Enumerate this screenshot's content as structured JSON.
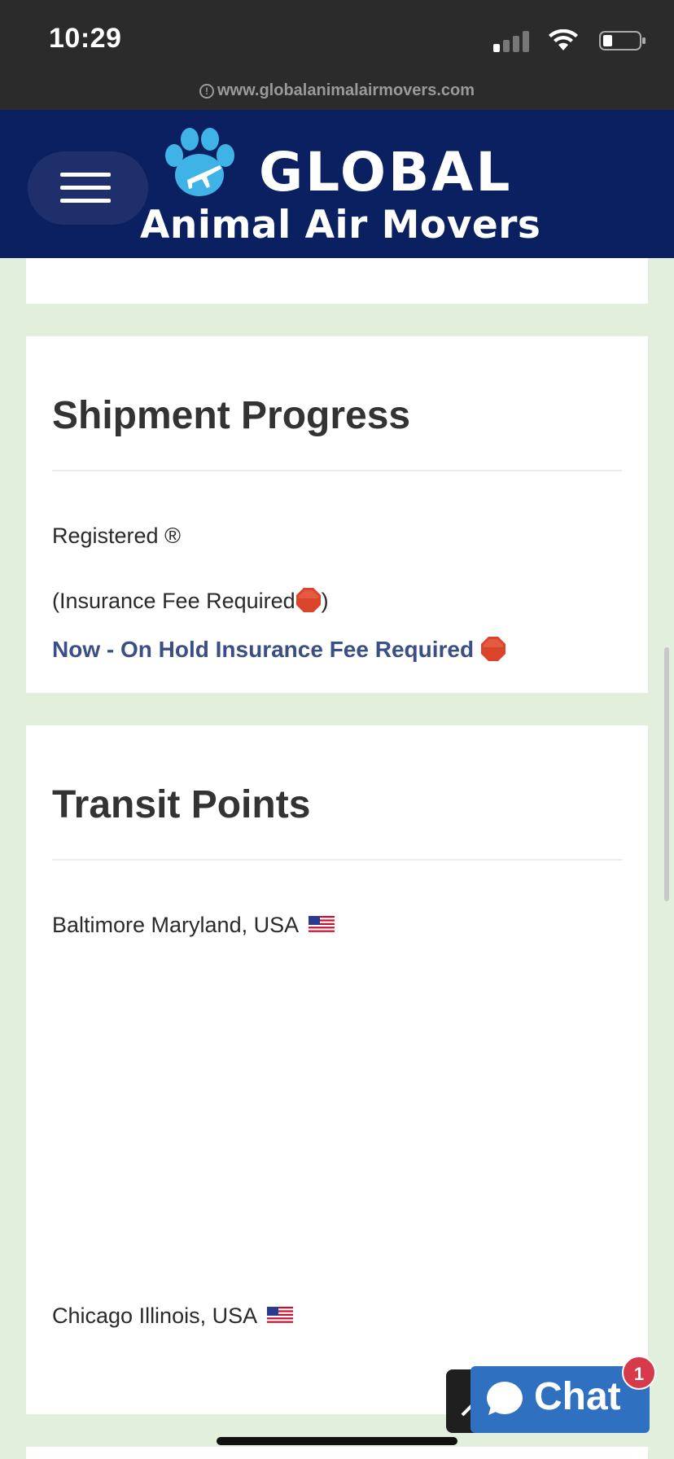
{
  "status_bar": {
    "time": "10:29"
  },
  "browser": {
    "url": "www.globalanimalairmovers.com"
  },
  "header": {
    "logo_line1": "GLOBAL",
    "logo_line2": "Animal Air Movers"
  },
  "shipment_progress": {
    "title": "Shipment Progress",
    "status": "Registered ®",
    "note": "(Insurance Fee Required",
    "note_close": ")",
    "current": "Now - On Hold Insurance Fee Required"
  },
  "transit_points": {
    "title": "Transit Points",
    "points": [
      "Baltimore Maryland, USA",
      "Chicago Illinois, USA"
    ]
  },
  "chat": {
    "label": "Chat",
    "badge": "1"
  },
  "colors": {
    "header_bg": "#0b2060",
    "page_bg": "#e2efdc",
    "accent_text": "#3a4f86",
    "chat_bg": "#2f70c1",
    "badge": "#d63a4b"
  }
}
